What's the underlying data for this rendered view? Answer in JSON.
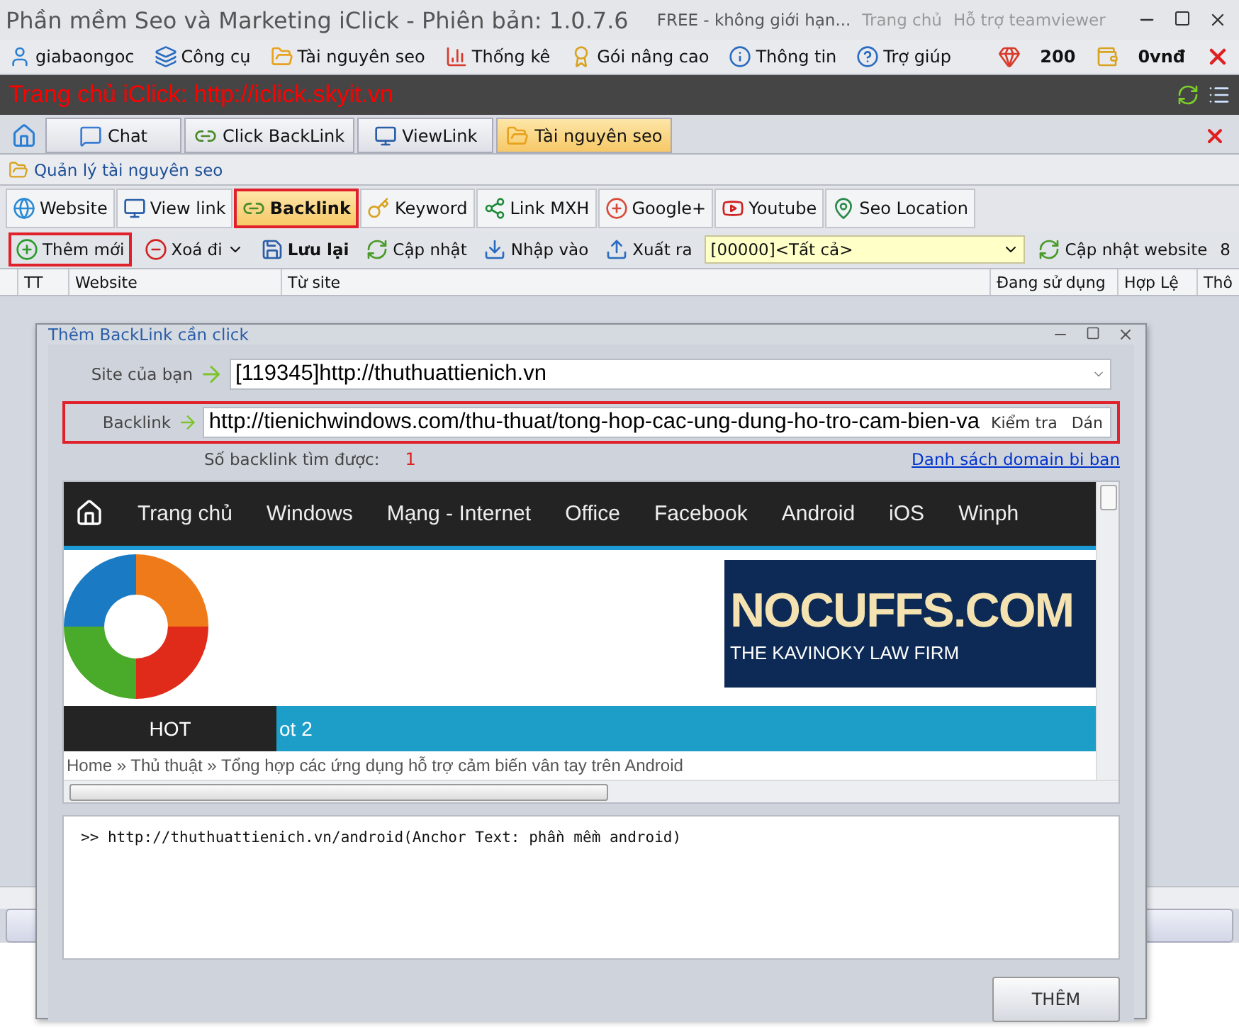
{
  "window": {
    "title": "Phần mềm Seo và Marketing iClick - Phiên bản: 1.0.7.6",
    "license": "FREE -  không giới hạn...",
    "links": [
      "Trang chủ",
      "Hỗ trợ teamviewer"
    ]
  },
  "menu": {
    "items": [
      "giabaongoc",
      "Công cụ",
      "Tài nguyên seo",
      "Thống kê",
      "Gói nâng cao",
      "Thông tin",
      "Trợ giúp"
    ],
    "points": "200",
    "balance": "0vnđ"
  },
  "banner": {
    "text": "Trang chủ iClick: http://iclick.skyit.vn"
  },
  "tabs": [
    {
      "label": "Chat",
      "selected": false
    },
    {
      "label": "Click BackLink",
      "selected": false
    },
    {
      "label": "ViewLink",
      "selected": false
    },
    {
      "label": "Tài nguyên seo",
      "selected": true
    }
  ],
  "section": {
    "title": "Quản lý tài nguyên seo"
  },
  "subtabs": [
    {
      "label": "Website",
      "selected": false,
      "highlighted": false
    },
    {
      "label": "View link",
      "selected": false,
      "highlighted": false
    },
    {
      "label": "Backlink",
      "selected": true,
      "highlighted": true
    },
    {
      "label": "Keyword",
      "selected": false,
      "highlighted": false
    },
    {
      "label": "Link MXH",
      "selected": false,
      "highlighted": false
    },
    {
      "label": "Google+",
      "selected": false,
      "highlighted": false
    },
    {
      "label": "Youtube",
      "selected": false,
      "highlighted": false
    },
    {
      "label": "Seo Location",
      "selected": false,
      "highlighted": false
    }
  ],
  "toolbar": {
    "buttons": [
      {
        "label": "Thêm mới",
        "highlighted": true,
        "bold": false
      },
      {
        "label": "Xoá đi",
        "highlighted": false,
        "bold": false
      },
      {
        "label": "Lưu lại",
        "highlighted": false,
        "bold": true
      },
      {
        "label": "Cập nhật",
        "highlighted": false,
        "bold": false
      },
      {
        "label": "Nhập vào",
        "highlighted": false,
        "bold": false
      },
      {
        "label": "Xuất ra",
        "highlighted": false,
        "bold": false
      }
    ],
    "filter": "[00000]<Tất cả>",
    "update_button": "Cập nhật website",
    "count": "8"
  },
  "table": {
    "columns": [
      "TT",
      "Website",
      "Từ site",
      "Đang sử dụng",
      "Hợp Lệ",
      "Thô"
    ]
  },
  "dialog": {
    "title": "Thêm BackLink cần click",
    "site_label": "Site của bạn",
    "site_value": "[119345]http://thuthuattienich.vn",
    "backlink_label": "Backlink",
    "backlink_value": "http://tienichwindows.com/thu-thuat/tong-hop-cac-ung-dung-ho-tro-cam-bien-va",
    "backlink_highlighted": true,
    "check_button": "Kiểm tra",
    "paste_button": "Dán",
    "found_label": "Số backlink tìm được:",
    "found_value": "1",
    "ban_link": "Danh sách domain bi ban",
    "preview": {
      "nav": [
        "Trang chủ",
        "Windows",
        "Mạng - Internet",
        "Office",
        "Facebook",
        "Android",
        "iOS",
        "Winph"
      ],
      "ad_title": "NOCUFFS.COM",
      "ad_subtitle": "THE KAVINOKY LAW FIRM",
      "hot_label": "HOT",
      "ticker": "ot 2",
      "breadcrumb": "Home  »  Thủ thuật  »  Tổng hợp các ứng dụng hỗ trợ cảm biến vân tay trên Android"
    },
    "log": ">> http://thuthuattienich.vn/android(Anchor Text: phần mềm android)",
    "add_button": "THÊM"
  }
}
